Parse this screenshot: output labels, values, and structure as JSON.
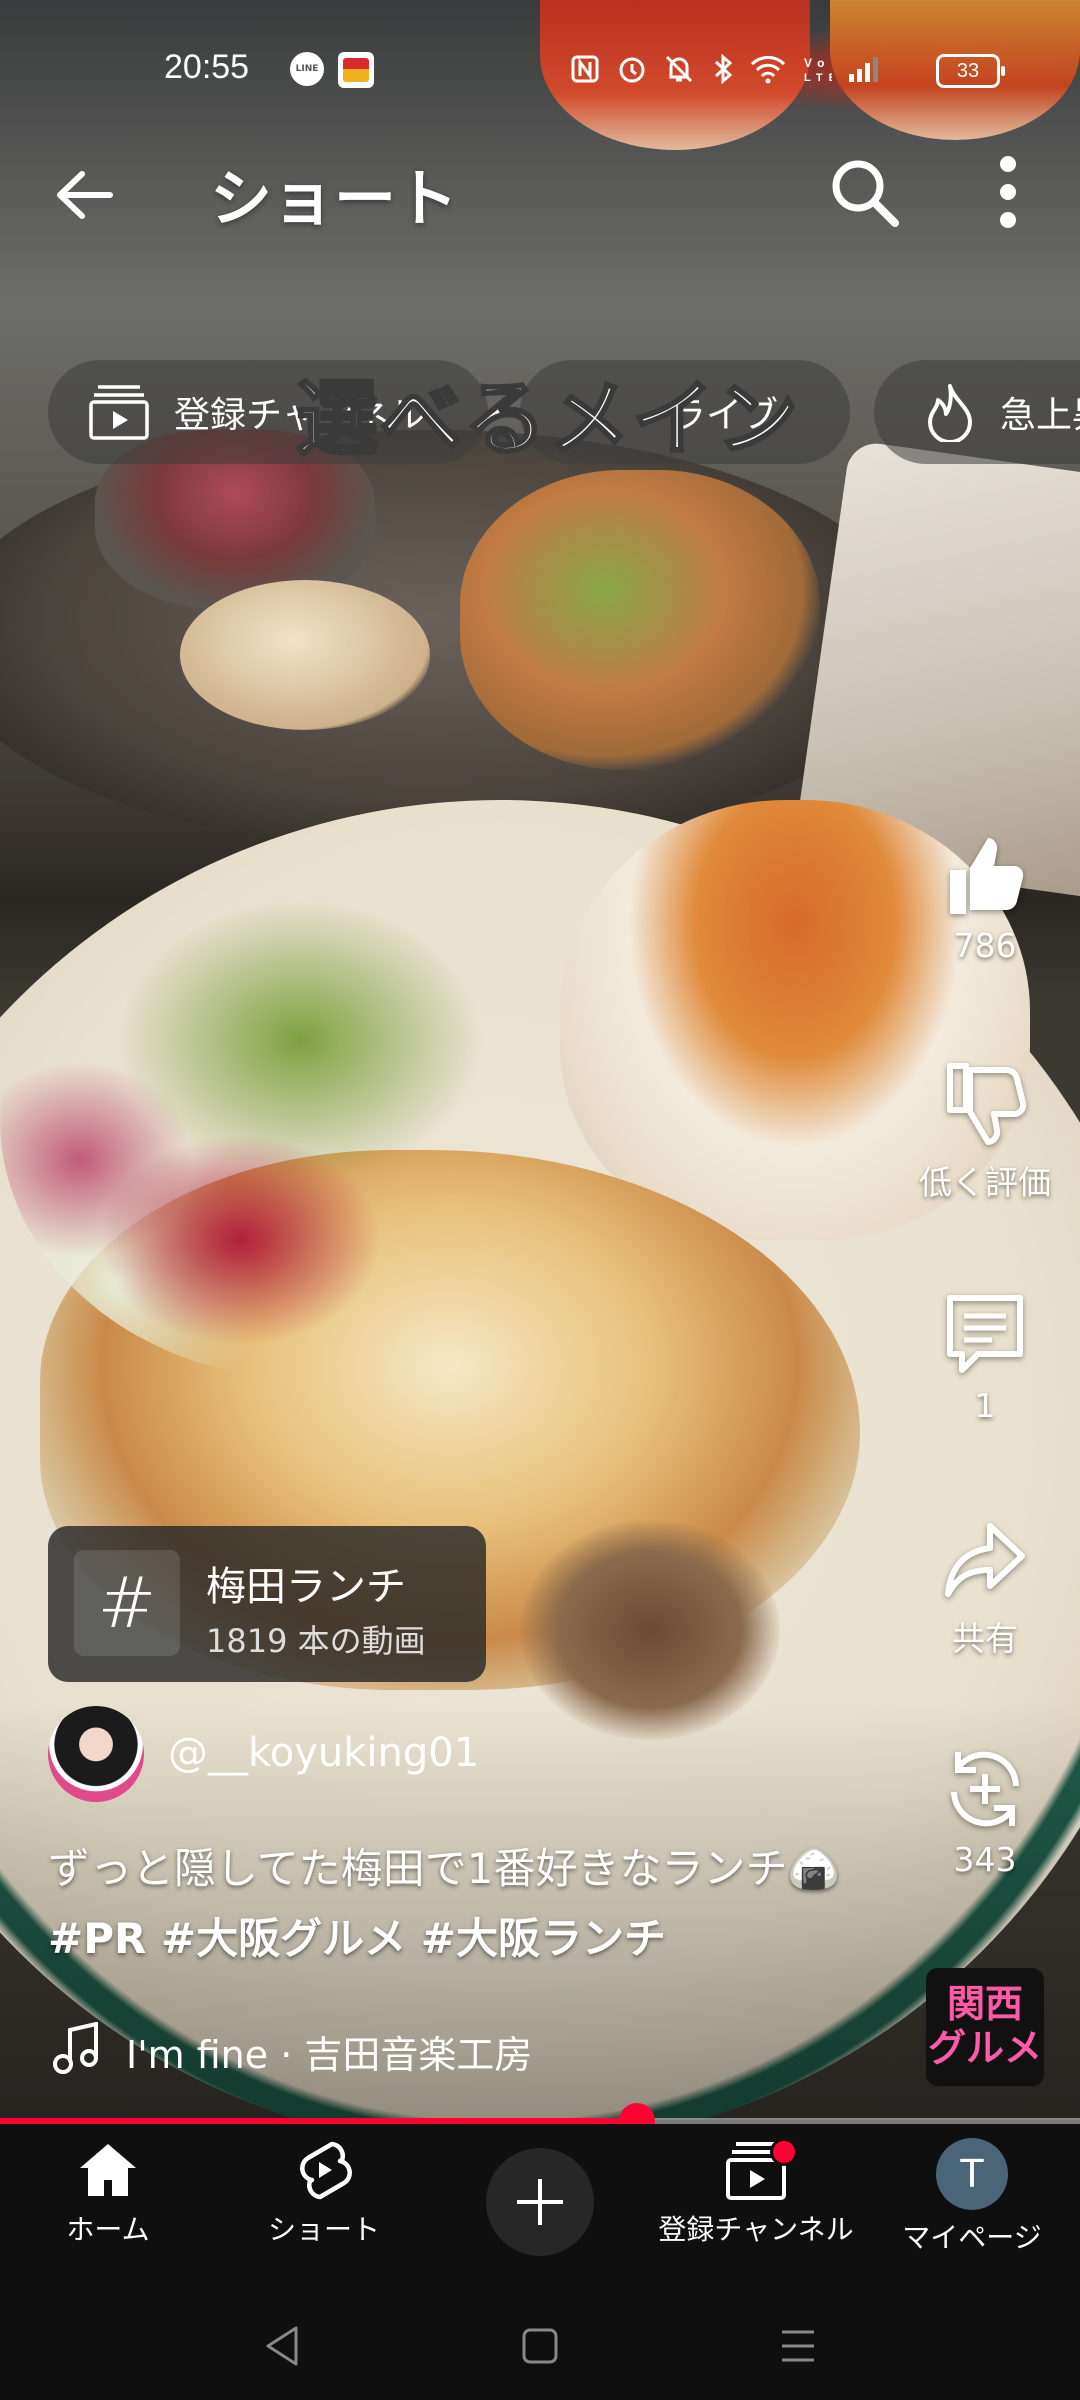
{
  "status_bar": {
    "time": "20:55",
    "battery": "33",
    "notification_icons": [
      "line-icon",
      "app-icon"
    ],
    "system_icons": [
      "nfc-icon",
      "alarm-icon",
      "mute-icon",
      "bluetooth-icon",
      "wifi-icon",
      "volte-icon",
      "signal-icon",
      "battery-icon"
    ]
  },
  "header": {
    "title": "ショート"
  },
  "chips": [
    {
      "label": "登録チャンネル",
      "icon": "subscriptions-icon"
    },
    {
      "label": "ライブ",
      "icon": "live-icon"
    },
    {
      "label": "急上昇",
      "icon": "trending-icon"
    }
  ],
  "video": {
    "overlay_text": "選べるメイン",
    "progress": 0.59
  },
  "actions": {
    "like_count": "786",
    "dislike_label": "低く評価",
    "comment_count": "1",
    "share_label": "共有",
    "remix_count": "343"
  },
  "hashtag": {
    "symbol": "#",
    "name": "梅田ランチ",
    "count": "1819 本の動画"
  },
  "channel": {
    "handle": "@__koyuking01"
  },
  "caption": {
    "text": "ずっと隠してた梅田で1番好きなランチ🍙",
    "tags": "#PR #大阪グルメ #大阪ランチ"
  },
  "music": {
    "label": "I'm fine · 吉田音楽工房"
  },
  "badge": {
    "line1": "関西",
    "line2": "グルメ"
  },
  "bottom_nav": {
    "home": "ホーム",
    "shorts": "ショート",
    "subscriptions": "登録チャンネル",
    "mypage": "マイページ",
    "avatar_letter": "T"
  },
  "colors": {
    "accent": "#ff0033",
    "background": "#0f0f0f",
    "badge_text": "#ff5aa8"
  }
}
